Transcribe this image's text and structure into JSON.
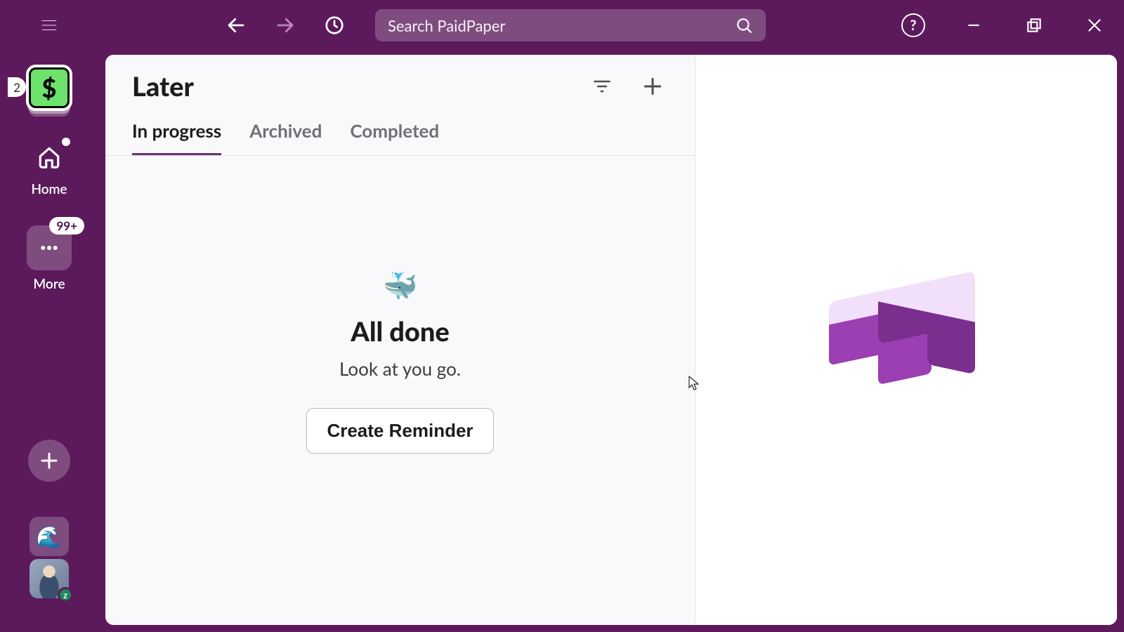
{
  "titlebar": {
    "search_placeholder": "Search PaidPaper"
  },
  "rail": {
    "workspace_badge": "2",
    "workspace_symbol": "$",
    "home_label": "Home",
    "more_label": "More",
    "more_badge": "99+",
    "status_emoji": "🌊",
    "presence_glyph": "z"
  },
  "later": {
    "title": "Later",
    "tabs": {
      "in_progress": "In progress",
      "archived": "Archived",
      "completed": "Completed"
    },
    "empty": {
      "emoji": "🐳",
      "heading": "All done",
      "sub": "Look at you go.",
      "button": "Create Reminder"
    }
  }
}
